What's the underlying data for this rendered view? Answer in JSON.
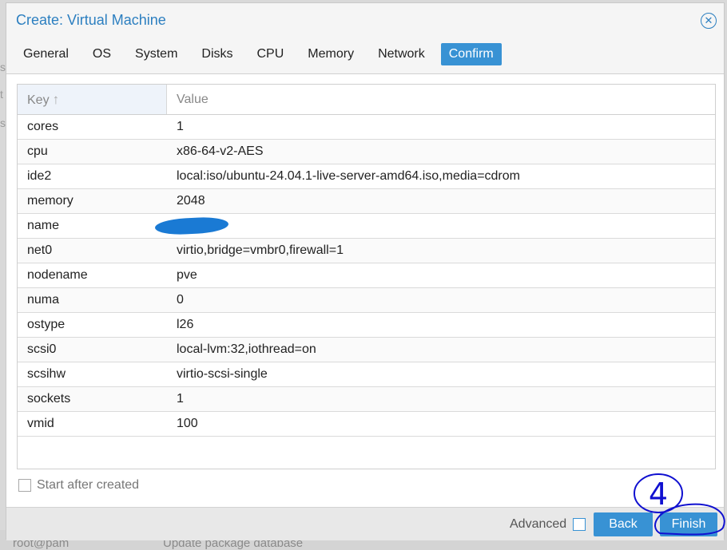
{
  "background": {
    "user": "root@pam",
    "task": "Update package database"
  },
  "dialog": {
    "title": "Create: Virtual Machine",
    "close_icon": "close-circle-icon"
  },
  "tabs": [
    {
      "label": "General",
      "active": false
    },
    {
      "label": "OS",
      "active": false
    },
    {
      "label": "System",
      "active": false
    },
    {
      "label": "Disks",
      "active": false
    },
    {
      "label": "CPU",
      "active": false
    },
    {
      "label": "Memory",
      "active": false
    },
    {
      "label": "Network",
      "active": false
    },
    {
      "label": "Confirm",
      "active": true
    }
  ],
  "table": {
    "headers": {
      "key": "Key",
      "value": "Value"
    },
    "sort_icon": "arrow-up-icon",
    "rows": [
      {
        "key": "cores",
        "value": "1"
      },
      {
        "key": "cpu",
        "value": "x86-64-v2-AES"
      },
      {
        "key": "ide2",
        "value": "local:iso/ubuntu-24.04.1-live-server-amd64.iso,media=cdrom"
      },
      {
        "key": "memory",
        "value": "2048"
      },
      {
        "key": "name",
        "value": "",
        "redacted": true
      },
      {
        "key": "net0",
        "value": "virtio,bridge=vmbr0,firewall=1"
      },
      {
        "key": "nodename",
        "value": "pve"
      },
      {
        "key": "numa",
        "value": "0"
      },
      {
        "key": "ostype",
        "value": "l26"
      },
      {
        "key": "scsi0",
        "value": "local-lvm:32,iothread=on"
      },
      {
        "key": "scsihw",
        "value": "virtio-scsi-single"
      },
      {
        "key": "sockets",
        "value": "1"
      },
      {
        "key": "vmid",
        "value": "100"
      }
    ]
  },
  "start_after_created": {
    "label": "Start after created",
    "checked": false
  },
  "footer": {
    "advanced_label": "Advanced",
    "advanced_checked": false,
    "back_label": "Back",
    "finish_label": "Finish"
  },
  "annotation": {
    "number": "4",
    "color": "#1010d0"
  },
  "colors": {
    "accent": "#3892d4",
    "title": "#2c7fc0",
    "redaction": "#1a7ad4"
  }
}
